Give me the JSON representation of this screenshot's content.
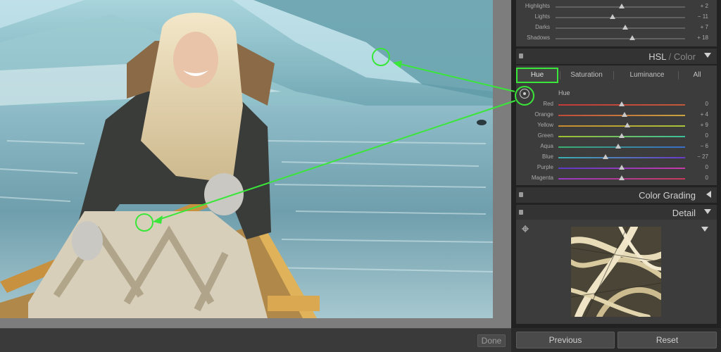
{
  "tone": {
    "sliders": [
      {
        "label": "Highlights",
        "value": "+ 2",
        "pos": 0.51
      },
      {
        "label": "Lights",
        "value": "− 11",
        "pos": 0.44
      },
      {
        "label": "Darks",
        "value": "+ 7",
        "pos": 0.54
      },
      {
        "label": "Shadows",
        "value": "+ 18",
        "pos": 0.59
      }
    ]
  },
  "hsl": {
    "title": "HSL",
    "title_sep": "/",
    "title_alt": "Color",
    "tabs": [
      "Hue",
      "Saturation",
      "Luminance",
      "All"
    ],
    "sub_heading": "Hue",
    "sliders": [
      {
        "label": "Red",
        "value": "0",
        "pos": 0.5,
        "grad": [
          "#c23a3a",
          "#c25a3a"
        ]
      },
      {
        "label": "Orange",
        "value": "+ 4",
        "pos": 0.52,
        "grad": [
          "#c24a3a",
          "#c9a640"
        ]
      },
      {
        "label": "Yellow",
        "value": "+ 9",
        "pos": 0.545,
        "grad": [
          "#c98a30",
          "#a8c63a"
        ]
      },
      {
        "label": "Green",
        "value": "0",
        "pos": 0.5,
        "grad": [
          "#a0c030",
          "#3ac09a"
        ]
      },
      {
        "label": "Aqua",
        "value": "− 6",
        "pos": 0.47,
        "grad": [
          "#3ab070",
          "#3a6cc8"
        ]
      },
      {
        "label": "Blue",
        "value": "− 27",
        "pos": 0.37,
        "grad": [
          "#3ab0b0",
          "#6a3ac8"
        ]
      },
      {
        "label": "Purple",
        "value": "0",
        "pos": 0.5,
        "grad": [
          "#5a3ac8",
          "#c83aa8"
        ]
      },
      {
        "label": "Magenta",
        "value": "0",
        "pos": 0.5,
        "grad": [
          "#9a3ac8",
          "#c83a5a"
        ]
      }
    ]
  },
  "color_grading": {
    "title": "Color Grading"
  },
  "detail": {
    "title": "Detail"
  },
  "buttons": {
    "done": "Done",
    "previous": "Previous",
    "reset": "Reset"
  },
  "colors": {
    "highlight": "#39e639"
  }
}
